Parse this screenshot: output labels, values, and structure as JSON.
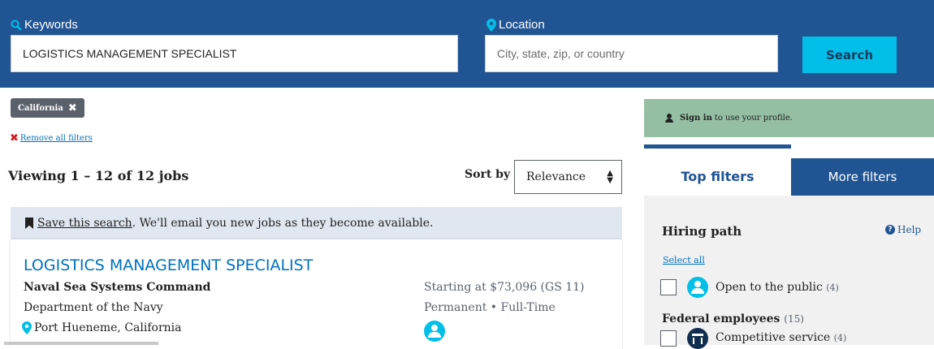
{
  "search": {
    "keywords_label": "Keywords",
    "keywords_value": "LOGISTICS MANAGEMENT SPECIALIST",
    "location_label": "Location",
    "location_placeholder": "City, state, zip, or country",
    "search_button": "Search"
  },
  "filters": {
    "active_chip": "California",
    "remove_all": "Remove all filters"
  },
  "results": {
    "viewing_text": "Viewing 1 – 12 of 12 jobs",
    "sort_label": "Sort by",
    "sort_value": "Relevance",
    "save_link": "Save this search",
    "save_text": ". We'll email you new jobs as they become available."
  },
  "job": {
    "title": "LOGISTICS MANAGEMENT SPECIALIST",
    "agency": "Naval Sea Systems Command",
    "department": "Department of the Navy",
    "location": "Port Hueneme, California",
    "salary": "Starting at $73,096 (GS 11)",
    "work_type": "Permanent • Full-Time"
  },
  "sidebar": {
    "signin_bold": "Sign in",
    "signin_text": "to use your profile.",
    "tab_top": "Top filters",
    "tab_more": "More filters",
    "hiring_path_title": "Hiring path",
    "help": "Help",
    "select_all": "Select all",
    "option_public_label": "Open to the public",
    "option_public_count": "(4)",
    "federal_label": "Federal employees",
    "federal_count": "(15)",
    "option_competitive_label": "Competitive service",
    "option_competitive_count": "(4)"
  },
  "colors": {
    "header_bg": "#205493",
    "accent": "#02bfe7",
    "link": "#0071bc",
    "signin_bg": "#94bfa2"
  }
}
